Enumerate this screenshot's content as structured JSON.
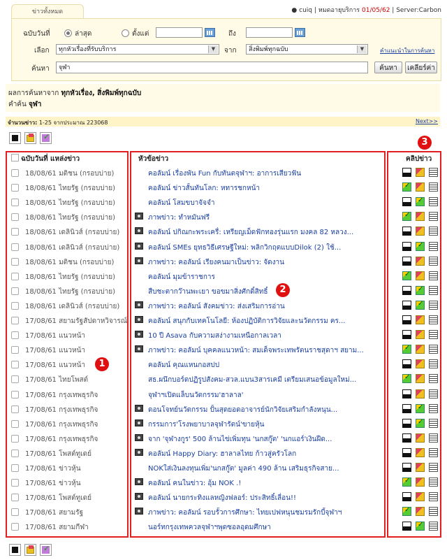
{
  "tab_label": "ข่าวทั้งหมด",
  "user": {
    "name": "cuiq",
    "service_label": "หมดอายุบริการ",
    "expiry": "01/05/62",
    "server": "Server:Carbon"
  },
  "search": {
    "date_label": "ฉบับวันที่",
    "latest_label": "ล่าสุด",
    "since_label": "ตั้งแต่",
    "to_label": "ถึง",
    "select_label": "เลือก",
    "topic_value": "ทุกหัวเรื่องที่รับบริการ",
    "from_label": "จาก",
    "source_value": "สิ่งพิมพ์ทุกฉบับ",
    "help_link": "คำแนะนำในการค้นหา",
    "query_label": "ค้นหา",
    "query_value": "จุฬา",
    "search_btn": "ค้นหา",
    "clear_btn": "เคลียร์ค่า"
  },
  "summary": {
    "line1_prefix": "ผลการค้นหาจาก",
    "line1_value": "ทุกหัวเรื่อง, สิ่งพิมพ์ทุกฉบับ",
    "line2_prefix": "คำค้น",
    "line2_value": "จุฬา"
  },
  "count": {
    "label": "จำนวนข่าว:",
    "text": "1-25 จากประมาณ 223068",
    "next": "Next>>"
  },
  "columns": {
    "date_source": "ฉบับวันที่ แหล่งข่าว",
    "headline": "หัวข้อข่าว",
    "clip": "คลิปข่าว"
  },
  "rows": [
    {
      "date": "18/08/61 มติชน (กรอบบ่าย)",
      "cam": false,
      "headline": "คอลัมน์ เรื่องพัน Fun กับทันตจุฬาฯ: อาการเสียวฟัน",
      "clips": [
        "doc",
        "fold",
        "note"
      ]
    },
    {
      "date": "18/08/61 ไทยรัฐ (กรอบบ่าย)",
      "cam": false,
      "headline": "คอลัมน์ ข่าวสั้นทันโลก: หทารชกหน้า",
      "clips": [
        "grn",
        "fold",
        "note"
      ]
    },
    {
      "date": "18/08/61 ไทยรัฐ (กรอบบ่าย)",
      "cam": false,
      "headline": "คอลัมน์ โสมขบาจัจจำ",
      "clips": [
        "doc",
        "grn",
        "note"
      ]
    },
    {
      "date": "18/08/61 ไทยรัฐ (กรอบบ่าย)",
      "cam": true,
      "headline": "ภาพข่าว: ทำหมันฟรี",
      "clips": [
        "grn",
        "fold",
        "note"
      ]
    },
    {
      "date": "18/08/61 เดลินิวส์ (กรอบบ่าย)",
      "cam": true,
      "headline": "คอลัมน์ ปกิณกะพระเครื่: เหรียญเม็ดฟักทองรุ่นแรก มงคล 82 หลวง...",
      "clips": [
        "doc",
        "fold",
        "note"
      ]
    },
    {
      "date": "18/08/61 เดลินิวส์ (กรอบบ่าย)",
      "cam": true,
      "headline": "คอลัมน์ SMEs ยุทธวิธีเศรษฐีใหม่: พลิกวิกฤตแบบDilok (2) ใช้...",
      "clips": [
        "doc",
        "grn",
        "note"
      ]
    },
    {
      "date": "18/08/61 มติชน (กรอบบ่าย)",
      "cam": true,
      "headline": "ภาพข่าว: คอลัมน์ เรียงคนมาเป็นข่าว: จัดงาน",
      "clips": [
        "doc",
        "fold",
        "note"
      ]
    },
    {
      "date": "18/08/61 ไทยรัฐ (กรอบบ่าย)",
      "cam": false,
      "headline": "คอลัมน์ มุมข้าราชการ",
      "clips": [
        "grn",
        "fold",
        "note"
      ]
    },
    {
      "date": "18/08/61 ไทยรัฐ (กรอบบ่าย)",
      "cam": false,
      "headline": "สืบชะตากว๊านพะเยา ขอขมาสิ่งศักดิ์สิทธิ์",
      "clips": [
        "doc",
        "grn",
        "note"
      ]
    },
    {
      "date": "18/08/61 เดลินิวส์ (กรอบบ่าย)",
      "cam": true,
      "headline": "ภาพข่าว: คอลัมน์ สังคมข่าว: ส่งเสริมการอ่าน",
      "clips": [
        "doc",
        "grn",
        "note"
      ]
    },
    {
      "date": "17/08/61 สยามรัฐสัปดาหวิจารณ์",
      "cam": true,
      "headline": "คอลัมน์ สนุกกับเทคโนโลยี: ห้องปฏิบัติการวิจัยและนวัตกรรม คร...",
      "clips": [
        "doc",
        "fold",
        "note"
      ]
    },
    {
      "date": "17/08/61 แนวหน้า",
      "cam": true,
      "headline": "10 ปี Asava กับความสง่างามเหนือกาลเวลา",
      "clips": [
        "doc",
        "fold",
        "note"
      ]
    },
    {
      "date": "17/08/61 แนวหน้า",
      "cam": true,
      "headline": "ภาพข่าว: คอลัมน์ บุคคลแนวหน้า: สมเด็จพระเทพรัตนราชสุดาฯ สยาม...",
      "clips": [
        "grn",
        "fold",
        "note"
      ]
    },
    {
      "date": "17/08/61 แนวหน้า",
      "cam": false,
      "headline": "คอลัมน์ คุณแหนกอสปป",
      "clips": [
        "doc",
        "fold",
        "note"
      ]
    },
    {
      "date": "17/08/61 ไทยโพสต์",
      "cam": false,
      "headline": "สธ.ผนึกบอร์ดปฏิรูปสังคม-สวล.แบน3สารเคมี เตรียมเสนอข้อมูลใหม่...",
      "clips": [
        "grn",
        "fold",
        "note"
      ]
    },
    {
      "date": "17/08/61 กรุงเทพธุรกิจ",
      "cam": false,
      "headline": "จุฬาฯเปิดแล็บนวัตกรรม'ฮาลาล'",
      "clips": [
        "doc",
        "fold",
        "note"
      ]
    },
    {
      "date": "17/08/61 กรุงเทพธุรกิจ",
      "cam": true,
      "headline": "ดอนโจทย์นวัตกรรม ปั้นสุดยอดอาจารย์นักวิจัยเสริมกำลังหนุน...",
      "clips": [
        "doc",
        "grn",
        "note"
      ]
    },
    {
      "date": "17/08/61 กรุงเทพธุรกิจ",
      "cam": true,
      "headline": "กรรมการ'โรงพยาบาลจุฬารัตน์'ขายหุ้น",
      "clips": [
        "doc",
        "grn",
        "note"
      ]
    },
    {
      "date": "17/08/61 กรุงเทพธุรกิจ",
      "cam": true,
      "headline": "จาก 'จุฬางกูร' 500 ล้านไข่เพิ่มทุน 'นกสกู๊ต' 'นกแอร์'เงินฝืด...",
      "clips": [
        "doc",
        "fold",
        "note"
      ]
    },
    {
      "date": "17/08/61 โพสต์ทูเดย์",
      "cam": true,
      "headline": "คอลัมน์ Happy Diary: ฮาลาลไทย ก้าวสู่ครัวโลก",
      "clips": [
        "doc",
        "fold",
        "note"
      ]
    },
    {
      "date": "17/08/61 ข่าวหุ้น",
      "cam": false,
      "headline": "NOKใส่เงินลงทุนเพิ่ม'นกสกู๊ต' มูลค่า 490 ล้าน เสริมธุรกิจสาย...",
      "clips": [
        "doc",
        "fold",
        "note"
      ]
    },
    {
      "date": "17/08/61 ข่าวหุ้น",
      "cam": true,
      "headline": "คอลัมน์ คนในข่าว: อุ้ม NOK .!",
      "clips": [
        "grn",
        "fold",
        "note"
      ]
    },
    {
      "date": "17/08/61 โพสต์ทูเดย์",
      "cam": true,
      "headline": "คอลัมน์ นายกระทิงแลหญิงฟลอร์: ประสิทธิ์เลื่อน!!",
      "clips": [
        "doc",
        "fold",
        "note"
      ]
    },
    {
      "date": "17/08/61 สยามรัฐ",
      "cam": true,
      "headline": "ภาพข่าว: คอลัมน์ รอบรั้วการศึกษา: ไทยเปฟหนุนชมรมรักบี้จุฬาฯ",
      "clips": [
        "grn",
        "fold",
        "note"
      ]
    },
    {
      "date": "17/08/61 สยามกีฬา",
      "cam": false,
      "headline": "นอร์ทกรุงเทพควลจุฬาฯพุดซอลอุดมศึกษา",
      "clips": [
        "doc",
        "grn",
        "note"
      ]
    }
  ],
  "markers": [
    "1",
    "2",
    "3"
  ]
}
